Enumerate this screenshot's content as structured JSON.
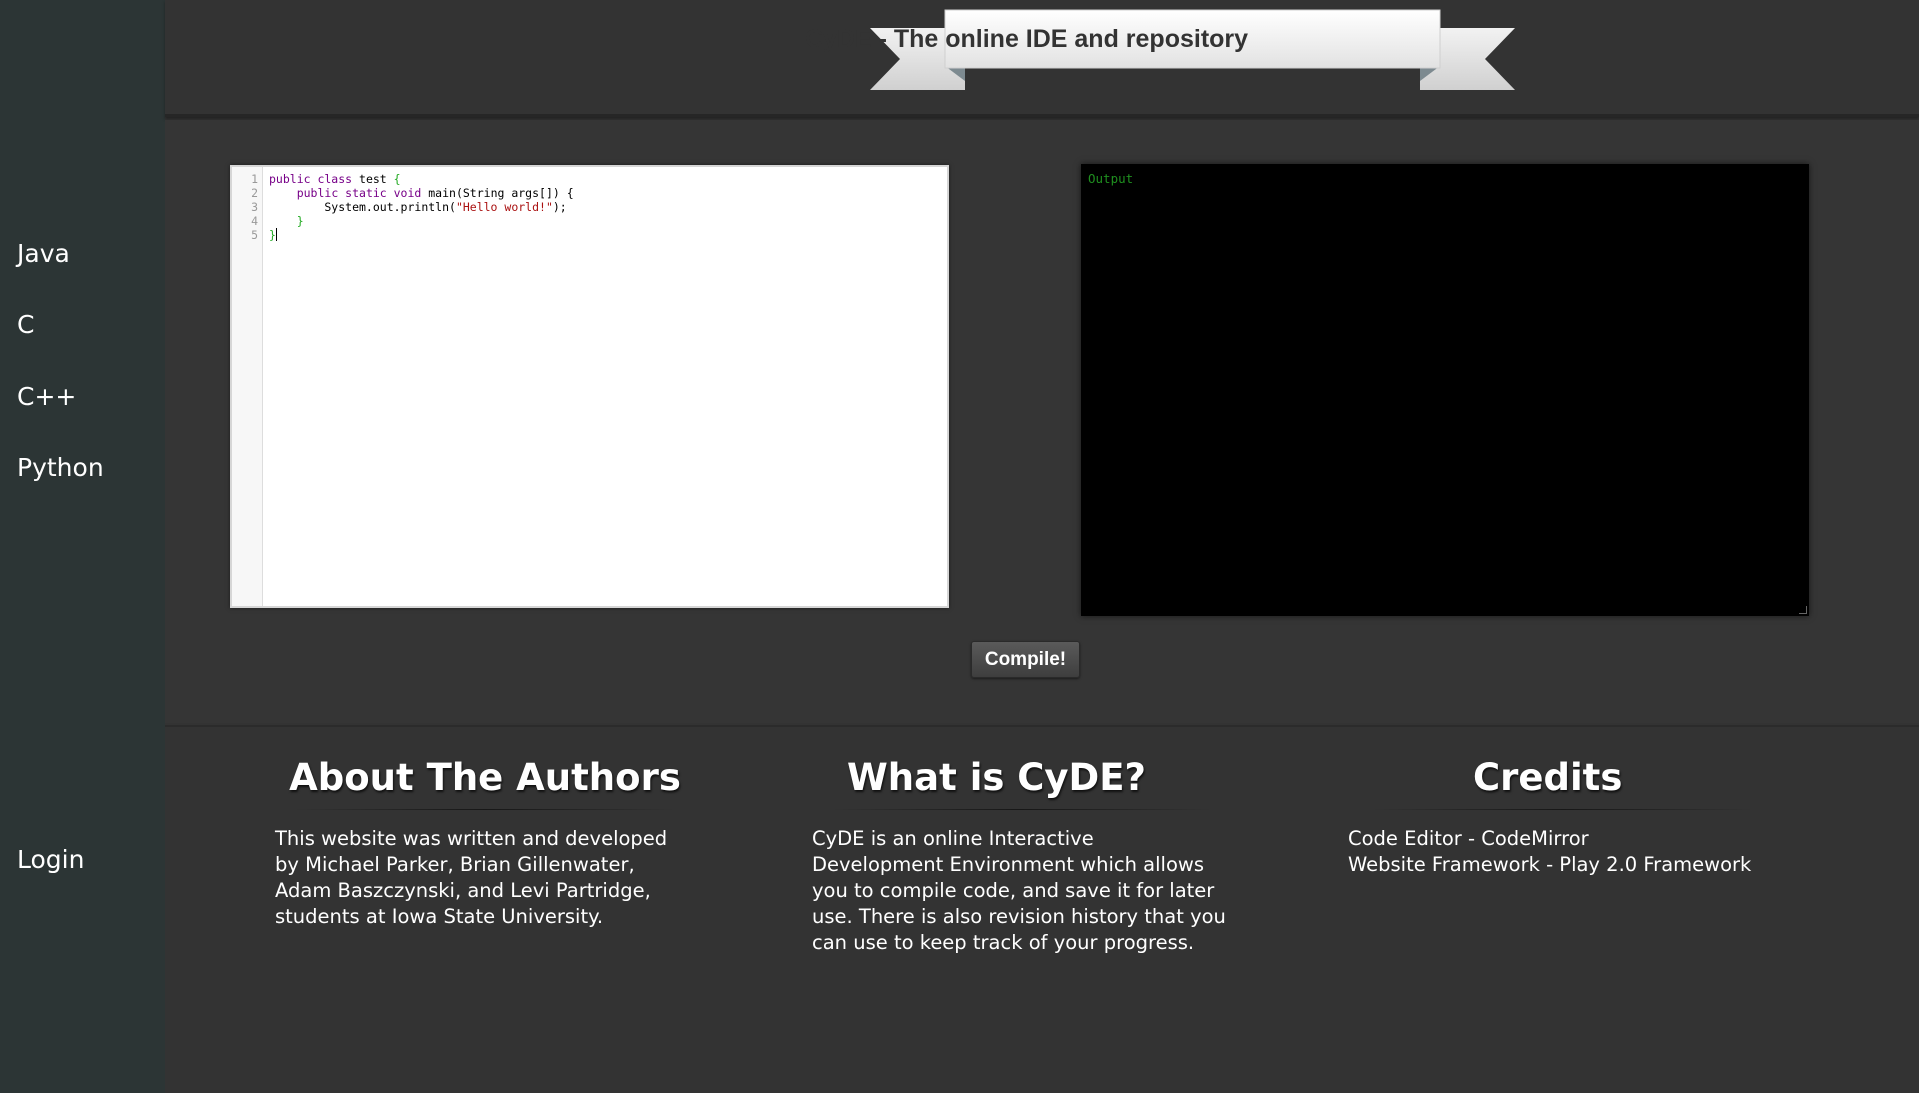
{
  "header": {
    "title": "CyDE - The online IDE and repository"
  },
  "sidebar": {
    "items": [
      {
        "label": "Java"
      },
      {
        "label": "C"
      },
      {
        "label": "C++"
      },
      {
        "label": "Python"
      }
    ],
    "login_label": "Login"
  },
  "editor": {
    "line_numbers": [
      "1",
      "2",
      "3",
      "4",
      "5"
    ],
    "code": {
      "l1_kw": "public class",
      "l1_rest": " test ",
      "l1_brace": "{",
      "l2_indent": "    ",
      "l2_kw": "public static void",
      "l2_rest": " main(String args[]) {",
      "l3_pre": "        System.out.println(",
      "l3_str": "\"Hello world!\"",
      "l3_post": ");",
      "l4_indent": "    ",
      "l4_brace": "}",
      "l5_brace": "}"
    }
  },
  "output": {
    "label": "Output"
  },
  "compile_button": {
    "label": "Compile!"
  },
  "footer": {
    "about": {
      "title": "About The Authors",
      "lines": [
        "This website was written and developed",
        "by Michael Parker, Brian Gillenwater,",
        "Adam Baszczynski, and Levi Partridge,",
        "students at Iowa State University."
      ]
    },
    "what": {
      "title": "What is CyDE?",
      "lines": [
        "CyDE is an online Interactive",
        "Development Environment which allows",
        "you to compile code, and save it for later",
        "use. There is also revision history that you",
        "can use to keep track of your progress."
      ]
    },
    "credits": {
      "title": "Credits",
      "lines": [
        "Code Editor - CodeMirror",
        "Website Framework - Play 2.0 Framework"
      ]
    }
  },
  "colors": {
    "sidebar_bg": "#2c3535",
    "page_bg": "#333333",
    "output_text": "#1f8f1f"
  }
}
